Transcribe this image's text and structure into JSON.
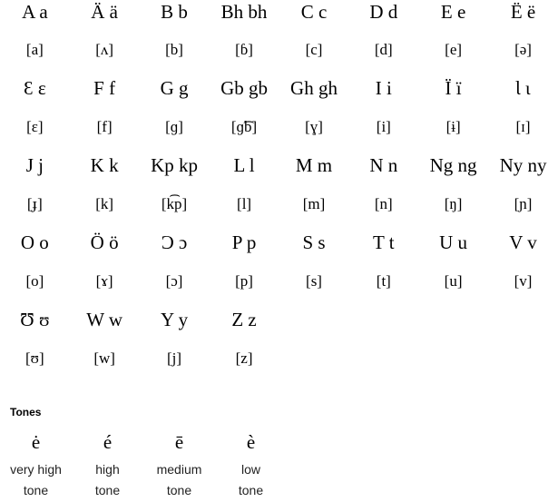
{
  "alphabet": [
    {
      "letter": "A a",
      "ipa": "[a]"
    },
    {
      "letter": "Ä ä",
      "ipa": "[ʌ]"
    },
    {
      "letter": "B b",
      "ipa": "[b]"
    },
    {
      "letter": "Bh bh",
      "ipa": "[ɓ]"
    },
    {
      "letter": "C c",
      "ipa": "[c]"
    },
    {
      "letter": "D d",
      "ipa": "[d]"
    },
    {
      "letter": "E e",
      "ipa": "[e]"
    },
    {
      "letter": "Ë ë",
      "ipa": "[ə]"
    },
    {
      "letter": "Ɛ ɛ",
      "ipa": "[ɛ]"
    },
    {
      "letter": "F f",
      "ipa": "[f]"
    },
    {
      "letter": "G g",
      "ipa": "[ɡ]"
    },
    {
      "letter": "Gb gb",
      "ipa": "[ɡ͡b]"
    },
    {
      "letter": "Gh gh",
      "ipa": "[ɣ]"
    },
    {
      "letter": "I i",
      "ipa": "[i]"
    },
    {
      "letter": "Ï ï",
      "ipa": "[ɨ]"
    },
    {
      "letter": "Ɩ ɩ",
      "ipa": "[ɪ]"
    },
    {
      "letter": "J j",
      "ipa": "[ɟ]"
    },
    {
      "letter": "K k",
      "ipa": "[k]"
    },
    {
      "letter": "Kp kp",
      "ipa": "[k͡p]"
    },
    {
      "letter": "L l",
      "ipa": "[l]"
    },
    {
      "letter": "M m",
      "ipa": "[m]"
    },
    {
      "letter": "N n",
      "ipa": "[n]"
    },
    {
      "letter": "Ng ng",
      "ipa": "[ŋ]"
    },
    {
      "letter": "Ny ny",
      "ipa": "[ɲ]"
    },
    {
      "letter": "O o",
      "ipa": "[o]"
    },
    {
      "letter": "Ö ö",
      "ipa": "[ɤ]"
    },
    {
      "letter": "Ɔ ɔ",
      "ipa": "[ɔ]"
    },
    {
      "letter": "P p",
      "ipa": "[p]"
    },
    {
      "letter": "S s",
      "ipa": "[s]"
    },
    {
      "letter": "T t",
      "ipa": "[t]"
    },
    {
      "letter": "U u",
      "ipa": "[u]"
    },
    {
      "letter": "V v",
      "ipa": "[v]"
    },
    {
      "letter": "Ʊ ʊ",
      "ipa": "[ʊ]"
    },
    {
      "letter": "W w",
      "ipa": "[w]"
    },
    {
      "letter": "Y y",
      "ipa": "[j]"
    },
    {
      "letter": "Z z",
      "ipa": "[z]"
    }
  ],
  "tones": {
    "heading": "Tones",
    "items": [
      {
        "mark": "ė",
        "label_line1": "very high",
        "label_line2": "tone"
      },
      {
        "mark": "é",
        "label_line1": "high",
        "label_line2": "tone"
      },
      {
        "mark": "ē",
        "label_line1": "medium",
        "label_line2": "tone"
      },
      {
        "mark": "è",
        "label_line1": "low",
        "label_line2": "tone"
      }
    ]
  }
}
